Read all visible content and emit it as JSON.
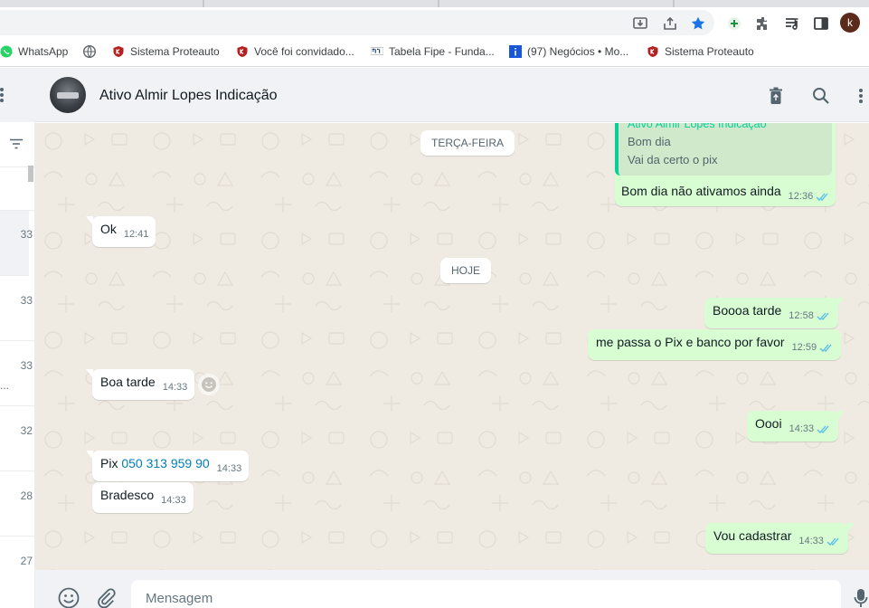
{
  "bookmarks": [
    {
      "label": "WhatsApp",
      "icon": "whatsapp-icon"
    },
    {
      "label": "",
      "icon": "globe-icon"
    },
    {
      "label": "Sistema Proteauto",
      "icon": "shield-logo-icon"
    },
    {
      "label": "Você foi convidado...",
      "icon": "shield-logo-icon"
    },
    {
      "label": "Tabela Fipe - Funda...",
      "icon": "fipe-icon"
    },
    {
      "label": "(97) Negócios • Mo...",
      "icon": "blue-i-icon"
    },
    {
      "label": "Sistema Proteauto",
      "icon": "shield-logo-icon"
    }
  ],
  "profile_initial": "k",
  "sidebar": {
    "times": [
      "33",
      "33",
      "33",
      "32",
      "28",
      "27"
    ],
    "truncation": "..."
  },
  "chat": {
    "title": "Ativo Almir Lopes Indicação",
    "days": {
      "d1": "TERÇA-FEIRA",
      "d2": "HOJE"
    },
    "quoted": {
      "author": "Ativo Almir Lopes Indicação",
      "line1": "Bom dia",
      "line2": "Vai da certo o pix"
    },
    "messages": {
      "m1": {
        "text": "Bom dia não ativamos ainda",
        "time": "12:36"
      },
      "m2": {
        "text": "Ok",
        "time": "12:41"
      },
      "m3": {
        "text": "Boooa tarde",
        "time": "12:58"
      },
      "m4": {
        "text": "me passa o Pix e banco por favor",
        "time": "12:59"
      },
      "m5": {
        "text": "Boa tarde",
        "time": "14:33"
      },
      "m6": {
        "text": "Oooi",
        "time": "14:33"
      },
      "m7": {
        "text": "Pix ",
        "link": "050 313 959 90",
        "time": "14:33"
      },
      "m8": {
        "text": "Bradesco",
        "time": "14:33"
      },
      "m9": {
        "text": "Vou cadastrar",
        "time": "14:33"
      }
    }
  },
  "composer": {
    "placeholder": "Mensagem"
  },
  "colors": {
    "outgoing_bubble": "#d9fdd3",
    "incoming_bubble": "#ffffff",
    "chat_background": "#efeae2",
    "read_tick": "#53bdeb",
    "quote_accent": "#06cf9c"
  }
}
